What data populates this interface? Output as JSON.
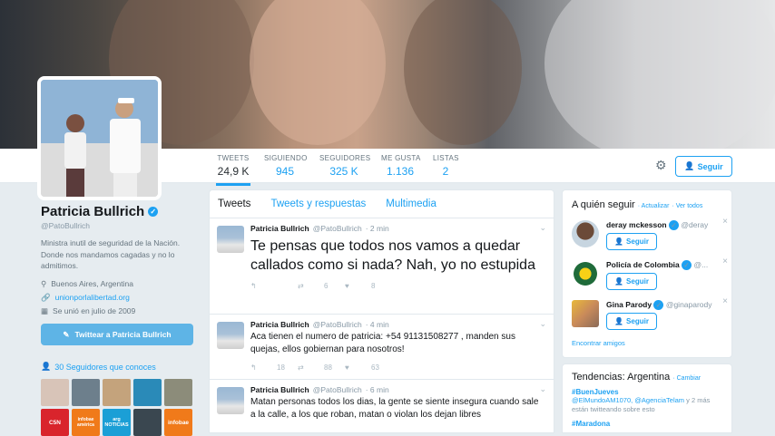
{
  "colors": {
    "accent": "#1da1f2",
    "background": "#e6ecf0"
  },
  "nav": {
    "stats": [
      {
        "label": "TWEETS",
        "value": "24,9 K"
      },
      {
        "label": "SIGUIENDO",
        "value": "945"
      },
      {
        "label": "SEGUIDORES",
        "value": "325 K"
      },
      {
        "label": "ME GUSTA",
        "value": "1.136"
      },
      {
        "label": "LISTAS",
        "value": "2"
      }
    ],
    "follow_label": "Seguir"
  },
  "profile": {
    "name": "Patricia Bullrich",
    "handle": "@PatoBullrich",
    "bio": "Ministra inutil de seguridad de la Nación. Donde nos mandamos cagadas y no lo admitimos.",
    "location": "Buenos Aires, Argentina",
    "website": "unionporlalibertad.org",
    "joined": "Se unió en julio de 2009",
    "tweet_to_label": "Twittear a Patricia Bullrich",
    "followers_you_know": "30 Seguidores que conoces"
  },
  "known_tiles": [
    "",
    "",
    "",
    "",
    "",
    "C5N",
    "infobae américa",
    "arg NOTICIAS",
    "",
    "infobae"
  ],
  "timeline": {
    "tabs": [
      "Tweets",
      "Tweets y respuestas",
      "Multimedia"
    ],
    "tweets": [
      {
        "name": "Patricia Bullrich",
        "handle": "@PatoBullrich",
        "time": "· 2 min",
        "text": "Te pensas que todos nos vamos a quedar callados como si nada? Nah, yo no estupida",
        "retweets": "6",
        "likes": "8"
      },
      {
        "name": "Patricia Bullrich",
        "handle": "@PatoBullrich",
        "time": "· 4 min",
        "text": "Aca tienen el numero de patricia: +54 91131508277 , manden sus quejas, ellos gobiernan para nosotros!",
        "replies": "18",
        "retweets": "88",
        "likes": "63"
      },
      {
        "name": "Patricia Bullrich",
        "handle": "@PatoBullrich",
        "time": "· 6 min",
        "text": "Matan personas todos los dias, la gente se siente insegura cuando sale a la calle, a los que roban, matan o violan los dejan libres"
      }
    ]
  },
  "who_to_follow": {
    "title": "A quién seguir",
    "refresh": "· Actualizar",
    "view_all": "· Ver todos",
    "users": [
      {
        "name": "deray mckesson",
        "handle": "@deray",
        "button": "Seguir"
      },
      {
        "name": "Policía de Colombia",
        "handle": "@...",
        "button": "Seguir"
      },
      {
        "name": "Gina Parody",
        "handle": "@ginaparody",
        "button": "Seguir"
      }
    ],
    "find_friends": "Encontrar amigos"
  },
  "trends": {
    "title": "Tendencias: Argentina",
    "change": "· Cambiar",
    "items": [
      {
        "name": "#BuenJueves",
        "desc_handles": "@ElMundoAM1070, @AgenciaTelam",
        "desc_rest": " y 2 más están twitteando sobre esto"
      },
      {
        "name": "#Maradona"
      }
    ]
  }
}
